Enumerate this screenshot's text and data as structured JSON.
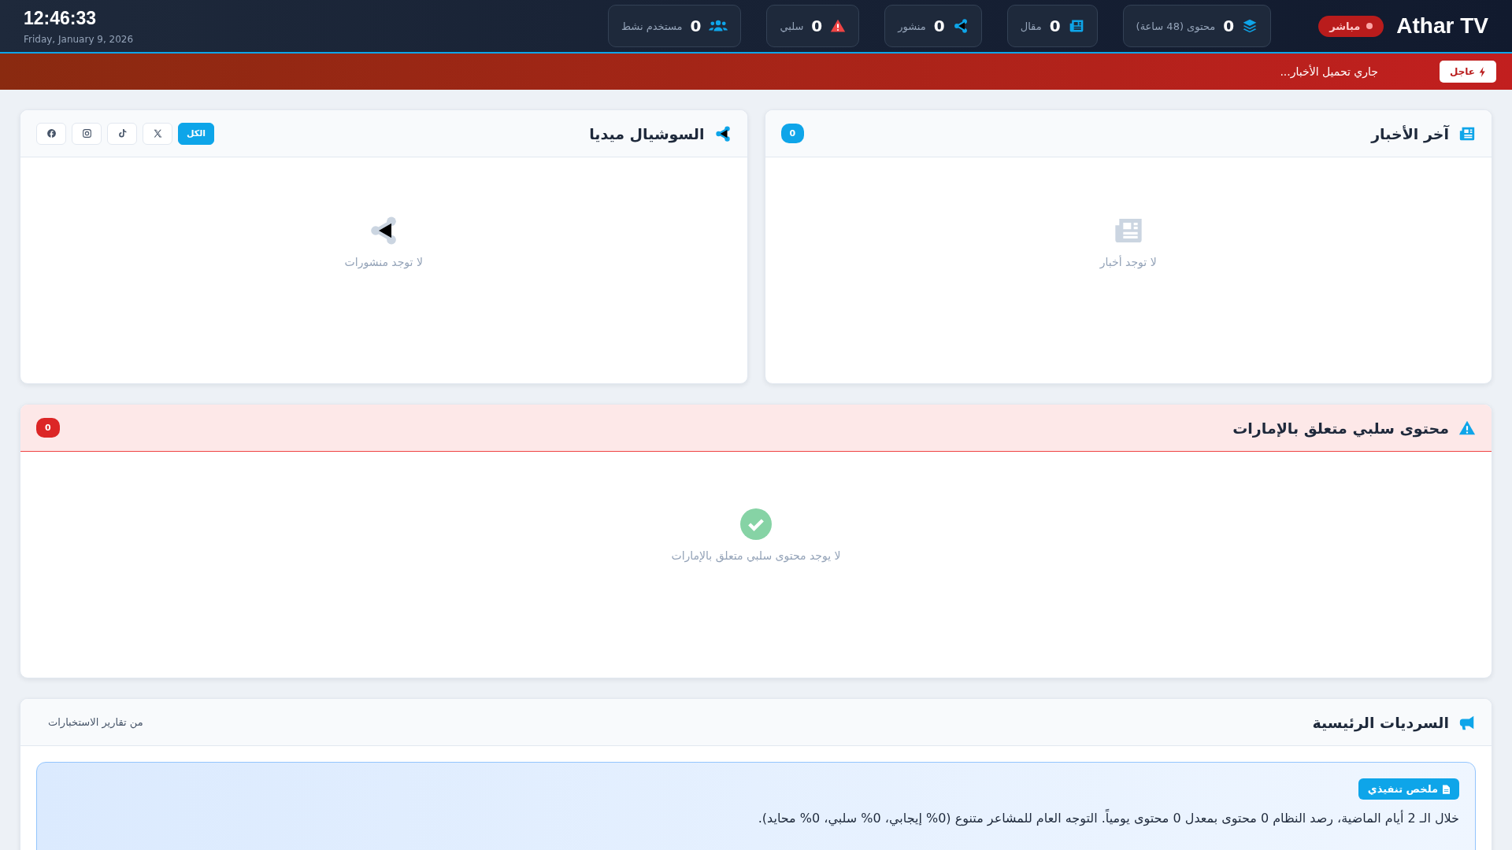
{
  "header": {
    "brand": "Athar TV",
    "live_badge": "مباشر",
    "stats": [
      {
        "kind": "content",
        "value": "0",
        "label": "محتوى (48 ساعة)"
      },
      {
        "kind": "article",
        "value": "0",
        "label": "مقال"
      },
      {
        "kind": "post",
        "value": "0",
        "label": "منشور"
      },
      {
        "kind": "negative",
        "value": "0",
        "label": "سلبي"
      },
      {
        "kind": "users",
        "value": "0",
        "label": "مستخدم نشط"
      }
    ],
    "clock": {
      "time": "12:46:33",
      "date": "Friday, January 9, 2026"
    }
  },
  "ticker": {
    "badge": "عاجل",
    "text": "جاري تحميل الأخبار..."
  },
  "news_panel": {
    "title": "آخر الأخبار",
    "count": "0",
    "empty_text": "لا توجد أخبار"
  },
  "social_panel": {
    "title": "السوشيال ميديا",
    "filters": [
      {
        "kind": "all",
        "label": "الكل",
        "selected": true
      },
      {
        "kind": "x",
        "selected": false
      },
      {
        "kind": "tiktok",
        "selected": false
      },
      {
        "kind": "instagram",
        "selected": false
      },
      {
        "kind": "facebook",
        "selected": false
      }
    ],
    "empty_text": "لا توجد منشورات"
  },
  "negative_panel": {
    "title": "محتوى سلبي متعلق بالإمارات",
    "count": "0",
    "empty_text": "لا يوجد محتوى سلبي متعلق بالإمارات"
  },
  "narratives_panel": {
    "title": "السرديات الرئيسية",
    "source": "من تقارير الاستخبارات",
    "summary": {
      "badge": "ملخص تنفيذي",
      "text": "خلال الـ 2 أيام الماضية، رصد النظام 0 محتوى بمعدل 0 محتوى يومياً. التوجه العام للمشاعر متنوع (0% إيجابي، 0% سلبي، 0% محايد)."
    }
  }
}
